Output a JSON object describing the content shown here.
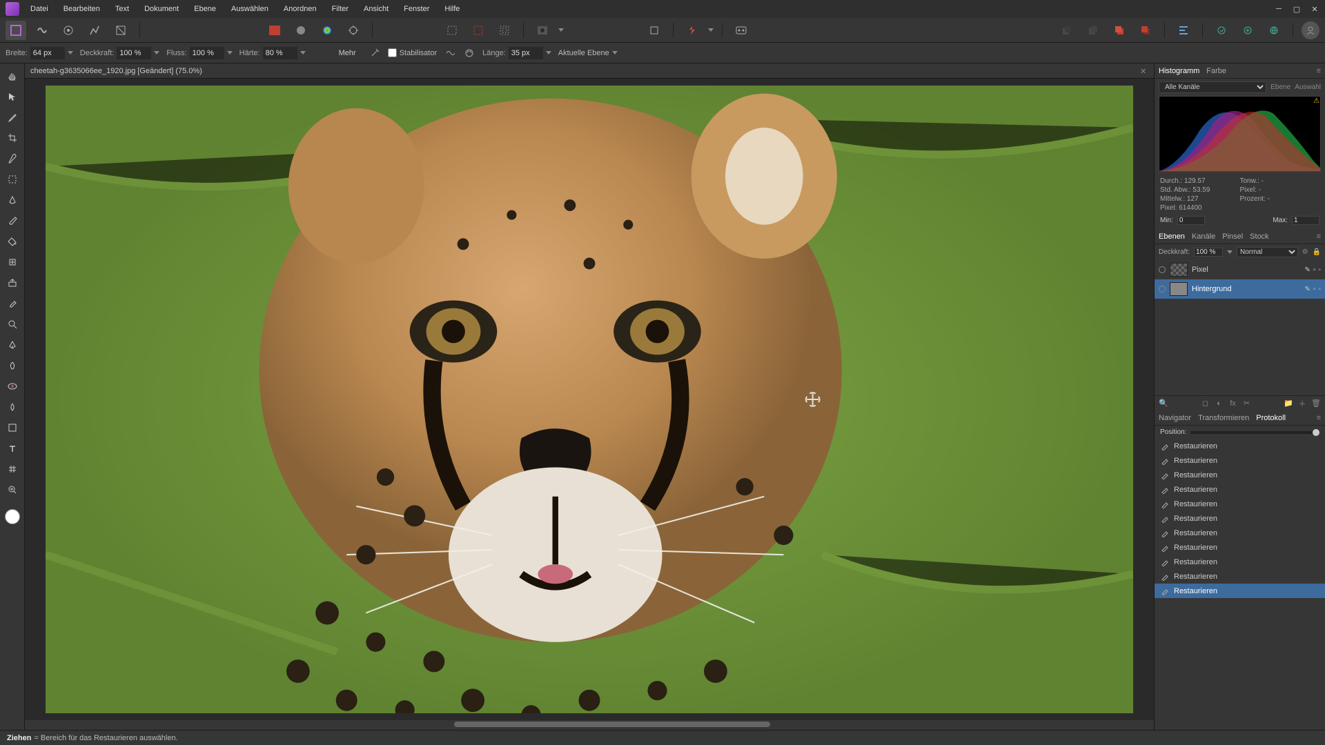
{
  "menu": [
    "Datei",
    "Bearbeiten",
    "Text",
    "Dokument",
    "Ebene",
    "Auswählen",
    "Anordnen",
    "Filter",
    "Ansicht",
    "Fenster",
    "Hilfe"
  ],
  "document_tab": "cheetah-g3635066ee_1920.jpg [Geändert] (75.0%)",
  "context": {
    "breite_label": "Breite:",
    "breite": "64 px",
    "deckkraft_label": "Deckkraft:",
    "deckkraft": "100 %",
    "fluss_label": "Fluss:",
    "fluss": "100 %",
    "haerte_label": "Härte:",
    "haerte": "80 %",
    "mehr": "Mehr",
    "stabilisator": "Stabilisator",
    "laenge_label": "Länge:",
    "laenge": "35 px",
    "aktuelle_ebene": "Aktuelle Ebene"
  },
  "histogram": {
    "tabs": [
      "Histogramm",
      "Farbe"
    ],
    "channel": "Alle Kanäle",
    "subtabs": [
      "Ebene",
      "Auswahl"
    ],
    "stats": {
      "durch": "Durch.: 129.57",
      "stdabw": "Std. Abw.: 53.59",
      "mittelw": "Mittelw.: 127",
      "pixel": "Pixel: 614400",
      "tonw": "Tonw.: -",
      "pixel2": "Pixel: -",
      "prozent": "Prozent: -"
    },
    "min_label": "Min:",
    "min": "0",
    "max_label": "Max:",
    "max": "1"
  },
  "layers": {
    "tabs": [
      "Ebenen",
      "Kanäle",
      "Pinsel",
      "Stock"
    ],
    "deckkraft_label": "Deckkraft:",
    "deckkraft": "100 %",
    "blend": "Normal",
    "items": [
      {
        "name": "Pixel",
        "selected": false,
        "checker": true
      },
      {
        "name": "Hintergrund",
        "selected": true,
        "checker": false
      }
    ]
  },
  "nav": {
    "tabs": [
      "Navigator",
      "Transformieren",
      "Protokoll"
    ],
    "position_label": "Position:"
  },
  "history_label": "Restaurieren",
  "history_count": 11,
  "status": {
    "action": "Ziehen",
    "hint": " = Bereich für das Restaurieren auswählen."
  }
}
